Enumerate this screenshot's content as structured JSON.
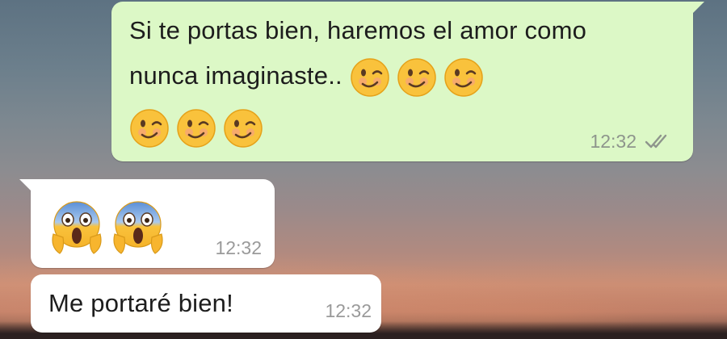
{
  "messages": [
    {
      "direction": "outgoing",
      "text": "Si te portas bien, haremos el amor como nunca imaginaste..",
      "emojis_inline": [
        "winking-face-emoji",
        "winking-face-emoji",
        "winking-face-emoji"
      ],
      "emojis_next_line": [
        "winking-face-emoji",
        "winking-face-emoji",
        "winking-face-emoji"
      ],
      "time": "12:32",
      "status_icon": "double-check-icon"
    },
    {
      "direction": "incoming",
      "emojis": [
        "face-screaming-in-fear-emoji",
        "face-screaming-in-fear-emoji"
      ],
      "time": "12:32"
    },
    {
      "direction": "incoming",
      "text": "Me portaré bien!",
      "time": "12:32"
    }
  ],
  "colors": {
    "outgoing_bubble": "#dcf8c6",
    "incoming_bubble": "#ffffff",
    "timestamp": "#8e958c"
  }
}
